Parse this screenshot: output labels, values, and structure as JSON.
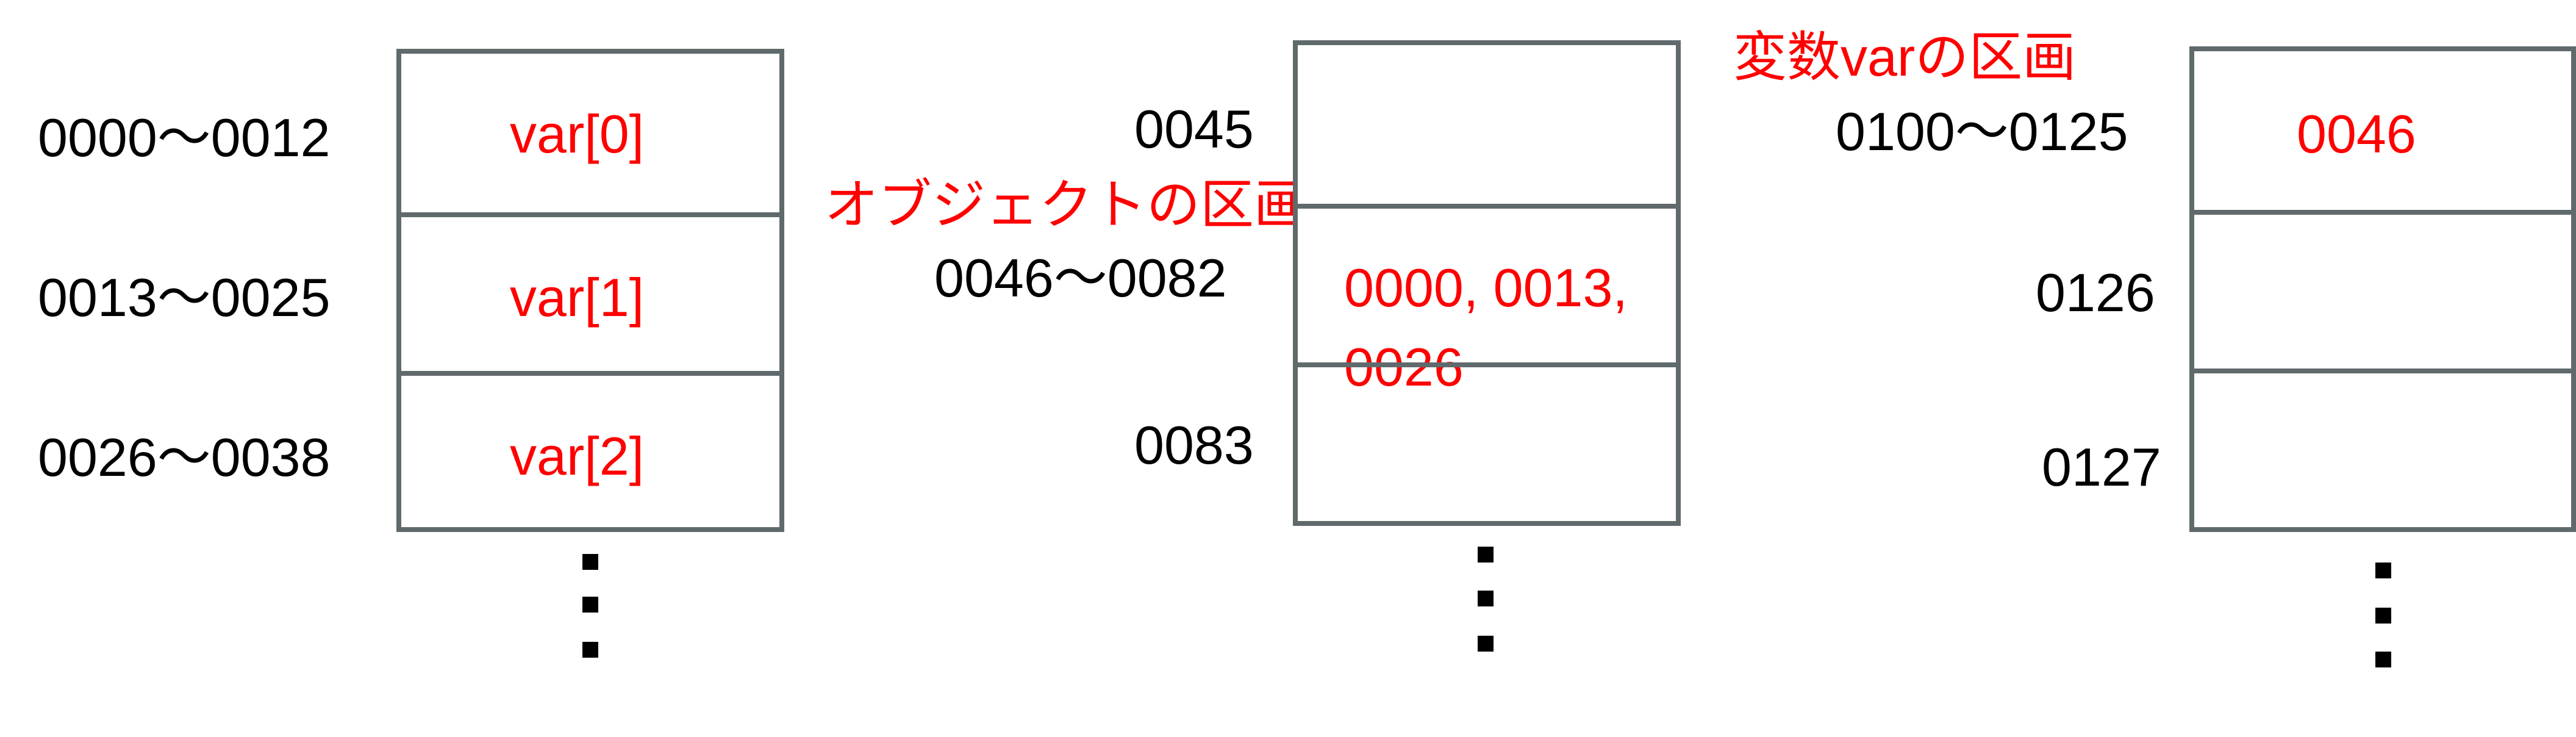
{
  "colors": {
    "border": "#606a6c",
    "annotation": "#ff0000",
    "label": "#000000"
  },
  "left_column": {
    "addresses": [
      "0000〜0012",
      "0013〜0025",
      "0026〜0038"
    ],
    "cells": [
      "var[0]",
      "var[1]",
      "var[2]"
    ]
  },
  "middle_column": {
    "caption": "オブジェクトの区画",
    "addresses": [
      "0045",
      "0046〜0082",
      "0083"
    ],
    "cell_lines": [
      "0000, 0013,",
      "0026"
    ]
  },
  "right_column": {
    "caption": "変数varの区画",
    "addresses": [
      "0100〜0125",
      "0126",
      "0127"
    ],
    "cell": "0046"
  }
}
